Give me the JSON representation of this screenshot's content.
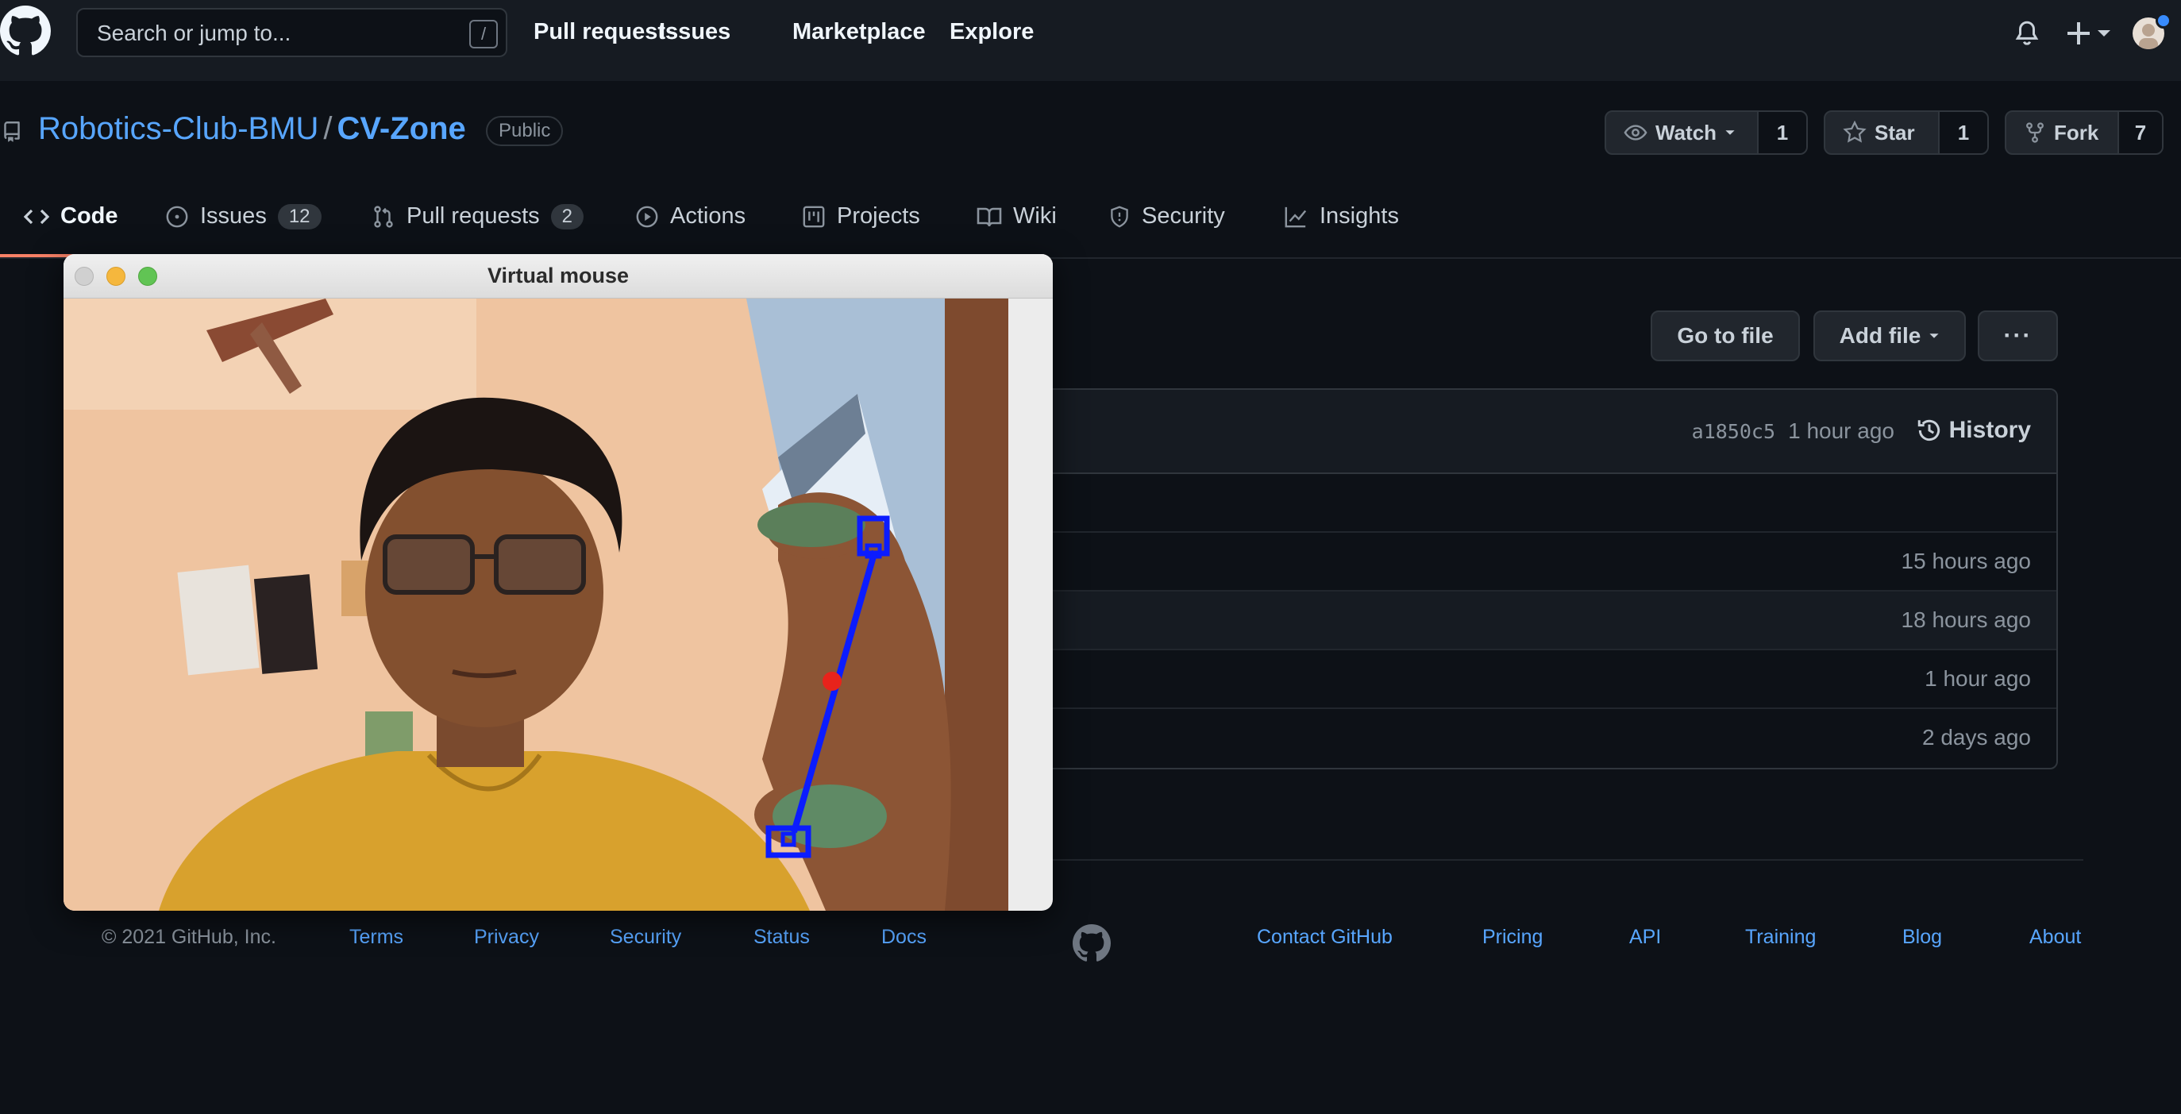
{
  "header": {
    "search_placeholder": "Search or jump to...",
    "search_shortcut": "/",
    "nav": [
      "Pull requests",
      "Issues",
      "Marketplace",
      "Explore"
    ]
  },
  "repo": {
    "owner": "Robotics-Club-BMU",
    "separator": "/",
    "name": "CV-Zone",
    "visibility": "Public",
    "watch_label": "Watch",
    "watch_count": "1",
    "star_label": "Star",
    "star_count": "1",
    "fork_label": "Fork",
    "fork_count": "7"
  },
  "tabs": [
    {
      "label": "Code"
    },
    {
      "label": "Issues",
      "count": "12"
    },
    {
      "label": "Pull requests",
      "count": "2"
    },
    {
      "label": "Actions"
    },
    {
      "label": "Projects"
    },
    {
      "label": "Wiki"
    },
    {
      "label": "Security"
    },
    {
      "label": "Insights"
    }
  ],
  "files": {
    "go_to_file": "Go to file",
    "add_file": "Add file",
    "more": "···",
    "commit_sha": "a1850c5",
    "commit_time": "1 hour ago",
    "history": "History",
    "rows": [
      {
        "age": ""
      },
      {
        "age": "15 hours ago"
      },
      {
        "age": "18 hours ago"
      },
      {
        "age": "1 hour ago"
      },
      {
        "age": "2 days ago"
      }
    ]
  },
  "footer": {
    "copyright": "© 2021 GitHub, Inc.",
    "left_links": [
      "Terms",
      "Privacy",
      "Security",
      "Status",
      "Docs"
    ],
    "right_links": [
      "Contact GitHub",
      "Pricing",
      "API",
      "Training",
      "Blog",
      "About"
    ]
  },
  "window": {
    "title": "Virtual mouse"
  },
  "colors": {
    "background": "#0d1117",
    "header": "#161b22",
    "link": "#58a6ff",
    "tab_underline": "#f78166",
    "tracking_line": "#0b1cff",
    "tracking_point": "#e8231b"
  }
}
